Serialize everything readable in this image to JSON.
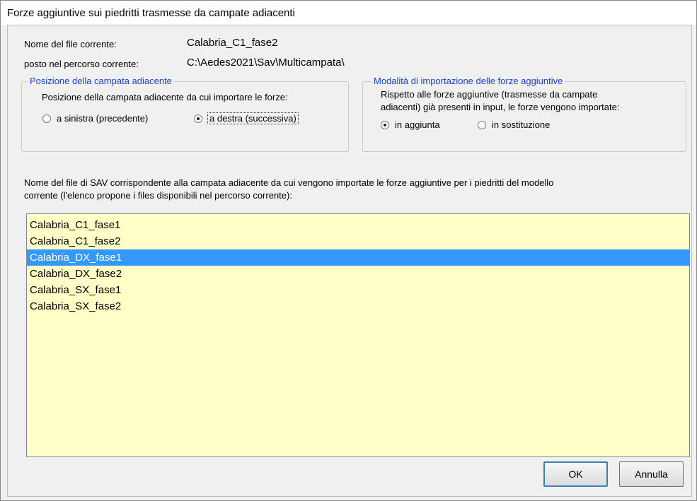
{
  "window": {
    "title": "Forze aggiuntive sui piedritti trasmesse da campate adiacenti"
  },
  "file_info": {
    "current_file_label": "Nome del file corrente:",
    "current_file_value": "Calabria_C1_fase2",
    "path_label": "posto nel percorso corrente:",
    "path_value": "C:\\Aedes2021\\Sav\\Multicampata\\"
  },
  "position_group": {
    "legend": "Posizione della campata adiacente",
    "description": "Posizione della campata adiacente da cui importare le forze:",
    "options": [
      {
        "label": "a sinistra (precedente)",
        "checked": false
      },
      {
        "label": "a destra (successiva)",
        "checked": true
      }
    ]
  },
  "import_mode_group": {
    "legend": "Modalità di importazione delle forze aggiuntive",
    "description_line1": "Rispetto alle forze aggiuntive (trasmesse da campate",
    "description_line2": "adiacenti) già presenti in input, le forze vengono importate:",
    "options": [
      {
        "label": "in aggiunta",
        "checked": true
      },
      {
        "label": "in sostituzione",
        "checked": false
      }
    ]
  },
  "file_list": {
    "caption_line1": "Nome del file di SAV corrispondente alla campata adiacente da cui vengono importate le forze aggiuntive per i piedritti del modello",
    "caption_line2": "corrente (l'elenco propone i files disponibili nel percorso corrente):",
    "items": [
      "Calabria_C1_fase1",
      "Calabria_C1_fase2",
      "Calabria_DX_fase1",
      "Calabria_DX_fase2",
      "Calabria_SX_fase1",
      "Calabria_SX_fase2"
    ],
    "selected_item": "Calabria_DX_fase1"
  },
  "buttons": {
    "ok_label": "OK",
    "cancel_label": "Annulla"
  },
  "colors": {
    "list_background": "#ffffc8",
    "selection": "#3399ff",
    "legend_text": "#1a3fc9"
  }
}
